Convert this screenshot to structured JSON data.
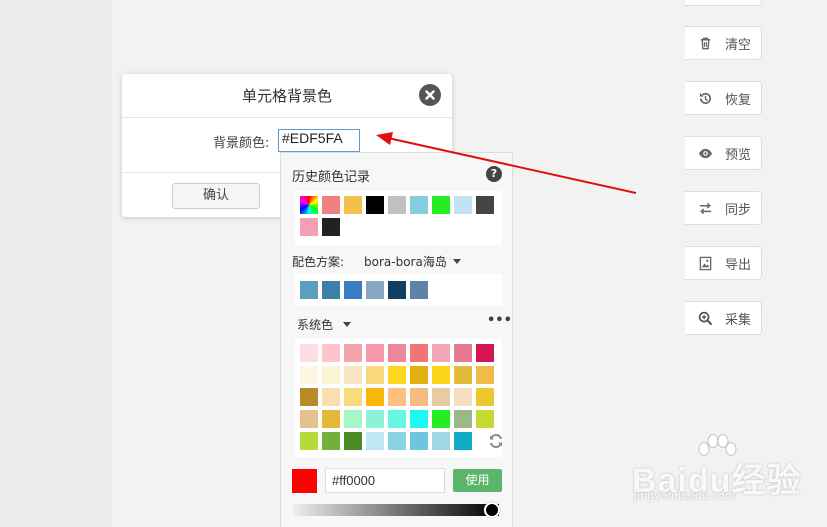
{
  "sidebar": {
    "items": [
      {
        "label": "清空",
        "icon": "trash-icon"
      },
      {
        "label": "恢复",
        "icon": "undo-icon"
      },
      {
        "label": "预览",
        "icon": "eye-icon"
      },
      {
        "label": "同步",
        "icon": "sync-arrows-icon"
      },
      {
        "label": "导出",
        "icon": "image-export-icon"
      },
      {
        "label": "采集",
        "icon": "zoom-in-icon"
      }
    ]
  },
  "dialog": {
    "title": "单元格背景色",
    "bg_label": "背景颜色:",
    "bg_value": "#EDF5FA",
    "ok_label": "确认"
  },
  "picker": {
    "history_title": "历史颜色记录",
    "help_glyph": "?",
    "history_colors": [
      "#f08080",
      "#f3c04a",
      "#000000",
      "#c0c0c0",
      "#87cde0",
      "#22ee22",
      "#c0e4f2",
      "#444444",
      "#f4a0b4",
      "#222222"
    ],
    "scheme_label": "配色方案:",
    "scheme_name": "bora-bora海岛",
    "scheme_colors": [
      "#5a9fc0",
      "#3c7fa8",
      "#3a7cc4",
      "#86a6c4",
      "#0f3f62",
      "#5f82a6"
    ],
    "system_label": "系统色",
    "more_glyph": "•••",
    "system_colors": [
      [
        "#fcdde3",
        "#fbc4cf",
        "#f2a6ac",
        "#f598ac",
        "#ef879c",
        "#f07478",
        "#f4a6b9",
        "#e37a92",
        "#d41554"
      ],
      [
        "#fdf6e3",
        "#fdf4d6",
        "#fae3c0",
        "#f8d87a",
        "#fcd61f",
        "#e3b010",
        "#fcd418",
        "#e3ba3a",
        "#f0bc48"
      ],
      [
        "#b88a28",
        "#f7dfb0",
        "#f8dc7c",
        "#f7b809",
        "#fdc080",
        "#f3bc80",
        "#e6cca2",
        "#f4dfc0",
        "#ebc830"
      ],
      [
        "#e4c290",
        "#e6b839",
        "#a6f6c6",
        "#8ef2d8",
        "#66f6e2",
        "#1afaf0",
        "#22ee22",
        "#9ab888",
        "#c6d832"
      ],
      [
        "#b3dc3a",
        "#72b03c",
        "#4a8a24",
        "#c0e6f4",
        "#88d4e4",
        "#6cc6df",
        "#a2d8e6",
        "#11acc6"
      ]
    ],
    "current_color": "#ff0000",
    "hex_value": "#ff0000",
    "use_label": "使用"
  },
  "watermark": {
    "text": "Baidu经验",
    "url": "jingyan.baidu.com"
  }
}
